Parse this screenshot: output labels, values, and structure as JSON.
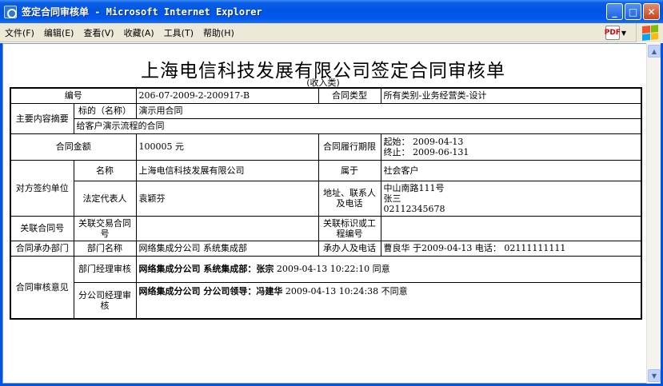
{
  "window": {
    "title": "签定合同审核单 - Microsoft Internet Explorer",
    "buttons": {
      "minimize": "_",
      "maximize": "□",
      "close": "✕"
    }
  },
  "menu": {
    "items": [
      "文件(F)",
      "编辑(E)",
      "查看(V)",
      "收藏(A)",
      "工具(T)",
      "帮助(H)"
    ],
    "pdf_label": "PDF"
  },
  "document": {
    "title": "上海电信科技发展有限公司签定合同审核单",
    "subtitle": "(收入类)",
    "labels": {
      "number": "编号",
      "contract_type": "合同类型",
      "summary": "主要内容摘要",
      "subject": "标的（名称）",
      "amount": "合同金额",
      "period": "合同履行期限",
      "counterparty": "对方签约单位",
      "name": "名称",
      "belongs": "属于",
      "legal_rep": "法定代表人",
      "address_contact": "地址、联系人及电话",
      "related_contract": "关联合同号",
      "related_deal": "关联交易合同号",
      "related_project": "关联标识或工程编号",
      "dept_undertake": "合同承办部门",
      "dept_name": "部门名称",
      "handler": "承办人及电话",
      "review": "合同审核意见",
      "dept_manager": "部门经理审核",
      "branch_manager": "分公司经理审核"
    },
    "values": {
      "number": "206-07-2009-2-200917-B",
      "contract_type": "所有类别-业务经营类-设计",
      "subject": "演示用合同",
      "summary_text": "给客户演示流程的合同",
      "amount": "100005 元",
      "period_start": "起始：  2009-04-13",
      "period_end": "终止：  2009-06-131",
      "counterparty_name": "上海电信科技发展有限公司",
      "belongs": "社会客户",
      "legal_rep": "袁颖芬",
      "address": "中山南路111号",
      "contact": "张三",
      "phone": "02112345678",
      "related_contract": "",
      "related_deal": "",
      "related_project": "",
      "dept_name": "网络集成分公司 系统集成部",
      "handler": "曹良华 于2009-04-13 电话：  02111111111",
      "dept_manager_name": "网络集成分公司 系统集成部：张宗",
      "dept_manager_time": " 2009-04-13 10:22:10 同意",
      "branch_manager_name": "网络集成分公司 分公司领导：冯建华",
      "branch_manager_time": " 2009-04-13 10:24:38 不同意"
    }
  }
}
